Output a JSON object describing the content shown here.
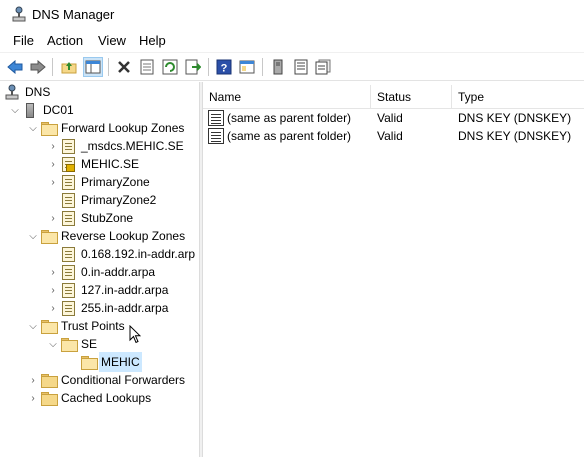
{
  "window": {
    "title": "DNS Manager"
  },
  "menu": [
    "File",
    "Action",
    "View",
    "Help"
  ],
  "toolbar": {
    "icons": [
      "back-arrow-icon",
      "forward-arrow-icon",
      "up-folder-icon",
      "show-console-tree-icon",
      "delete-icon",
      "properties-icon",
      "refresh-icon",
      "export-list-icon",
      "help-icon",
      "mmc-icon",
      "server-icon",
      "record-icon",
      "record-copy-icon"
    ]
  },
  "tree": {
    "root": "DNS",
    "server": "DC01",
    "forward_lookup_zones": "Forward Lookup Zones",
    "forward_zones": [
      "_msdcs.MEHIC.SE",
      "MEHIC.SE",
      "PrimaryZone",
      "PrimaryZone2",
      "StubZone"
    ],
    "reverse_lookup_zones": "Reverse Lookup Zones",
    "reverse_zones": [
      "0.168.192.in-addr.arp",
      "0.in-addr.arpa",
      "127.in-addr.arpa",
      "255.in-addr.arpa"
    ],
    "trust_points": "Trust Points",
    "trust_se": "SE",
    "trust_mehic": "MEHIC",
    "conditional_forwarders": "Conditional Forwarders",
    "cached_lookups": "Cached Lookups"
  },
  "list": {
    "columns": {
      "name": "Name",
      "status": "Status",
      "type": "Type"
    },
    "rows": [
      {
        "name": "(same as parent folder)",
        "status": "Valid",
        "type": "DNS KEY (DNSKEY)"
      },
      {
        "name": "(same as parent folder)",
        "status": "Valid",
        "type": "DNS KEY (DNSKEY)"
      }
    ]
  },
  "colors": {
    "selection": "#cce8ff",
    "toolbar_active": "#cce4f7",
    "folder": "#f5d889"
  }
}
